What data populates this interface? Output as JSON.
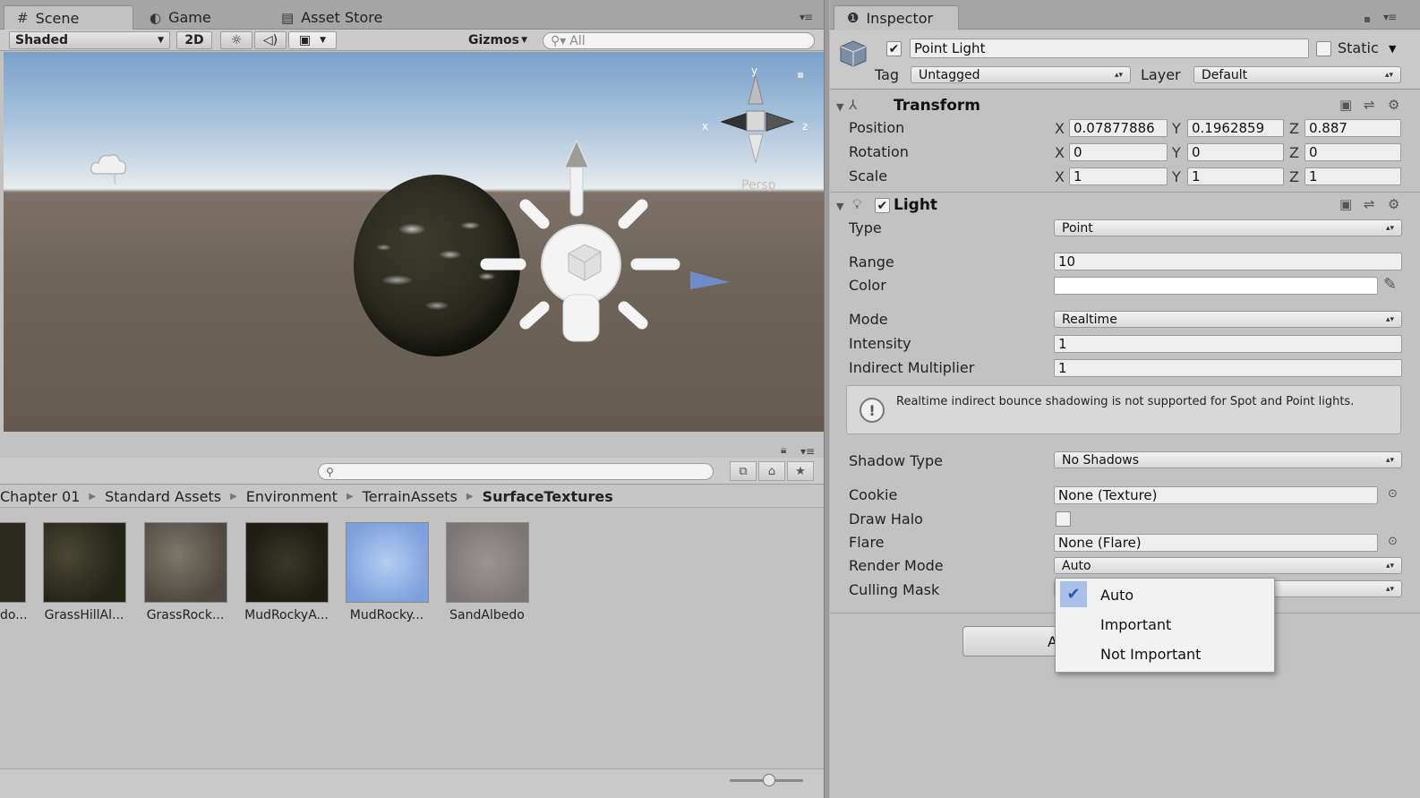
{
  "tabs": {
    "scene": "Scene",
    "game": "Game",
    "asset_store": "Asset Store"
  },
  "toolbar": {
    "shading_mode": "Shaded",
    "mode_2d": "2D",
    "gizmos": "Gizmos",
    "search_placeholder": "All"
  },
  "viewport": {
    "projection_label": "Persp",
    "axis_x": "x",
    "axis_y": "y",
    "axis_z": "z"
  },
  "project": {
    "breadcrumb": [
      "Chapter 01",
      "Standard Assets",
      "Environment",
      "TerrainAssets",
      "SurfaceTextures"
    ],
    "assets": [
      {
        "label": "do...",
        "color": "#2c2a20"
      },
      {
        "label": "GrassHillAl...",
        "color": "#2f2e22"
      },
      {
        "label": "GrassRock...",
        "color": "#615a50"
      },
      {
        "label": "MudRockyA...",
        "color": "#2a281c"
      },
      {
        "label": "MudRocky...",
        "color": "#8daee2"
      },
      {
        "label": "SandAlbedo",
        "color": "#8b8685"
      }
    ]
  },
  "inspector": {
    "tab": "Inspector",
    "object_name": "Point Light",
    "static_label": "Static",
    "tag_label": "Tag",
    "tag_value": "Untagged",
    "layer_label": "Layer",
    "layer_value": "Default",
    "transform": {
      "title": "Transform",
      "position_label": "Position",
      "rotation_label": "Rotation",
      "scale_label": "Scale",
      "position": {
        "x": "0.07877886",
        "y": "0.1962859",
        "z": "0.887"
      },
      "rotation": {
        "x": "0",
        "y": "0",
        "z": "0"
      },
      "scale": {
        "x": "1",
        "y": "1",
        "z": "1"
      }
    },
    "light": {
      "title": "Light",
      "type_label": "Type",
      "type_value": "Point",
      "range_label": "Range",
      "range_value": "10",
      "color_label": "Color",
      "mode_label": "Mode",
      "mode_value": "Realtime",
      "intensity_label": "Intensity",
      "intensity_value": "1",
      "indirect_label": "Indirect Multiplier",
      "indirect_value": "1",
      "info_text": "Realtime indirect bounce shadowing is not supported for Spot and Point lights.",
      "shadow_label": "Shadow Type",
      "shadow_value": "No Shadows",
      "cookie_label": "Cookie",
      "cookie_value": "None (Texture)",
      "halo_label": "Draw Halo",
      "flare_label": "Flare",
      "flare_value": "None (Flare)",
      "render_mode_label": "Render Mode",
      "render_mode_value": "Auto",
      "culling_label": "Culling Mask"
    },
    "render_mode_options": [
      "Auto",
      "Important",
      "Not Important"
    ],
    "add_component_partial": "A"
  },
  "colors": {
    "panel": "#c2c2c2",
    "tab_bar": "#a5a5a5",
    "selection": "#a9c1e6",
    "check": "#2d5aa8"
  }
}
